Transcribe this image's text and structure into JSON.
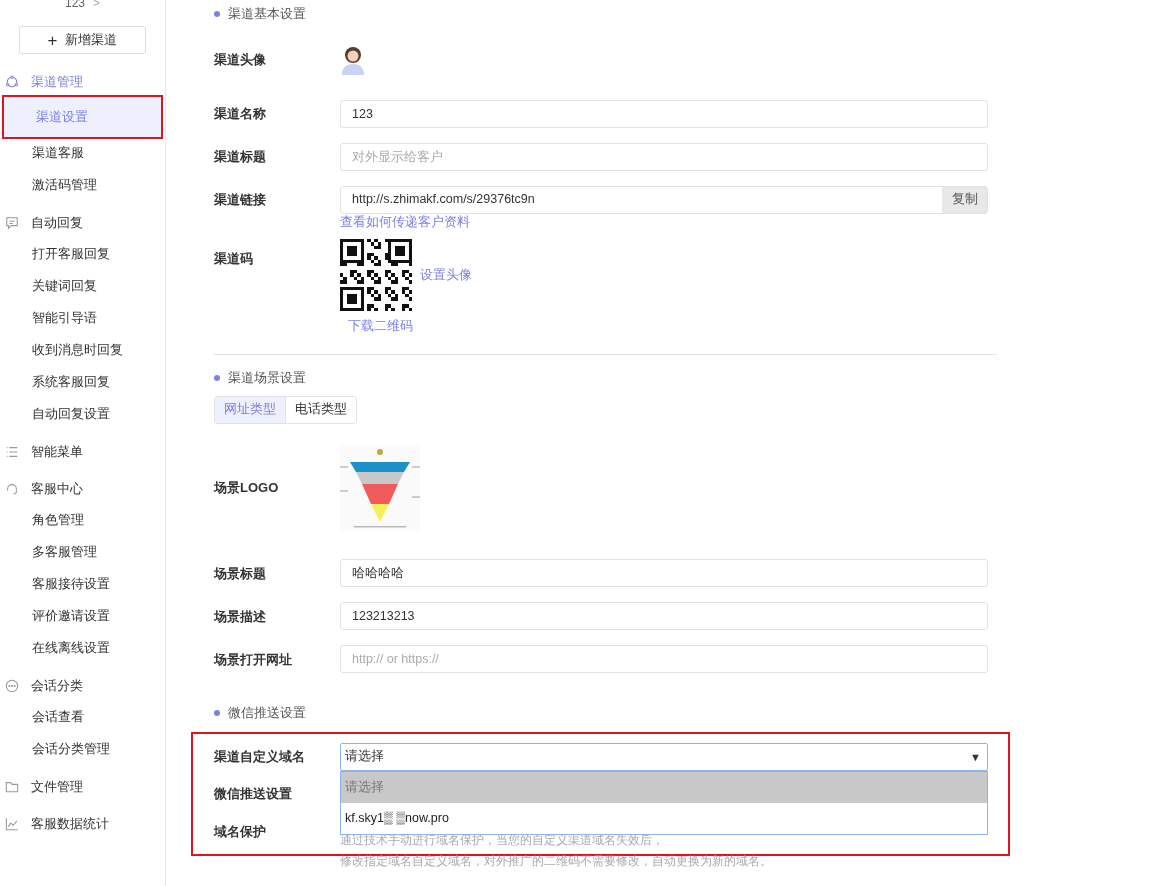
{
  "sidebar": {
    "channel_name": "123",
    "chevron": ">",
    "add_icon": "+",
    "add_button": "新增渠道",
    "groups": [
      {
        "label": "渠道管理",
        "selected": true,
        "items": [
          {
            "label": "渠道设置",
            "selected": true
          },
          {
            "label": "渠道客服",
            "selected": false
          },
          {
            "label": "激活码管理",
            "selected": false
          }
        ]
      },
      {
        "label": "自动回复",
        "selected": false,
        "items": [
          {
            "label": "打开客服回复",
            "selected": false
          },
          {
            "label": "关键词回复",
            "selected": false
          },
          {
            "label": "智能引导语",
            "selected": false
          },
          {
            "label": "收到消息时回复",
            "selected": false
          },
          {
            "label": "系统客服回复",
            "selected": false
          },
          {
            "label": "自动回复设置",
            "selected": false
          }
        ]
      },
      {
        "label": "智能菜单",
        "selected": false
      },
      {
        "label": "客服中心",
        "selected": false,
        "items": [
          {
            "label": "角色管理",
            "selected": false
          },
          {
            "label": "多客服管理",
            "selected": false
          },
          {
            "label": "客服接待设置",
            "selected": false
          },
          {
            "label": "评价邀请设置",
            "selected": false
          },
          {
            "label": "在线离线设置",
            "selected": false
          }
        ]
      },
      {
        "label": "会话分类",
        "selected": false,
        "items": [
          {
            "label": "会话查看",
            "selected": false
          },
          {
            "label": "会话分类管理",
            "selected": false
          }
        ]
      },
      {
        "label": "文件管理",
        "selected": false
      },
      {
        "label": "客服数据统计",
        "selected": false
      }
    ]
  },
  "basic": {
    "heading": "渠道基本设置",
    "avatar_label": "渠道头像",
    "name": {
      "label": "渠道名称",
      "value": "123"
    },
    "title": {
      "label": "渠道标题",
      "placeholder": "对外显示给客户"
    },
    "link": {
      "label": "渠道链接",
      "value": "http://s.zhimakf.com/s/29376tc9n",
      "copy_button": "复制",
      "help_link": "查看如何传递客户资料"
    },
    "code": {
      "label": "渠道码",
      "set_avatar": "设置头像",
      "download": "下载二维码"
    }
  },
  "scene": {
    "heading": "渠道场景设置",
    "tabs": [
      {
        "label": "网址类型",
        "selected": true
      },
      {
        "label": "电话类型",
        "selected": false
      }
    ],
    "logo_label": "场景LOGO",
    "title": {
      "label": "场景标题",
      "value": "哈哈哈哈"
    },
    "description": {
      "label": "场景描述",
      "value": "123213213"
    },
    "url": {
      "label": "场景打开网址",
      "placeholder": "http:// or https://"
    }
  },
  "wechat": {
    "heading": "微信推送设置",
    "domain": {
      "label": "渠道自定义域名",
      "value": "请选择",
      "caret": "▼",
      "expanded": true,
      "options": [
        {
          "label": "请选择",
          "selected": true
        },
        {
          "label": "kf.sky1▒ ▒now.pro",
          "selected": false
        }
      ]
    },
    "push_label": "微信推送设置",
    "protect_label": "域名保护",
    "protect_help": [
      "通过技术手动进行域名保护，当您的自定义渠道域名失效后，",
      "修改指定域名自定义域名，对外推广的二维码不需要修改，自动更换为新的域名。"
    ]
  }
}
